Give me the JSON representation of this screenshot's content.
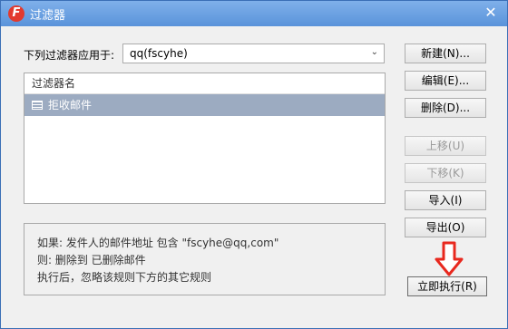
{
  "window": {
    "title": "过滤器"
  },
  "apply": {
    "label": "下列过滤器应用于:",
    "account": "qq(fscyhe)"
  },
  "list": {
    "header": "过滤器名",
    "rows": [
      {
        "name": "拒收邮件"
      }
    ]
  },
  "description": {
    "line1": "如果: 发件人的邮件地址 包含 \"fscyhe@qq,com\"",
    "line2": "则:  删除到 已删除邮件",
    "line3": "执行后，忽略该规则下方的其它规则"
  },
  "buttons": {
    "new": "新建(N)...",
    "edit": "编辑(E)...",
    "delete": "删除(D)...",
    "move_up": "上移(U)",
    "move_down": "下移(K)",
    "import": "导入(I)",
    "export": "导出(O)",
    "execute": "立即执行(R)"
  },
  "colors": {
    "title_bar": "#5a93da",
    "selected_row": "#9cabc1",
    "arrow": "#e8281e"
  }
}
